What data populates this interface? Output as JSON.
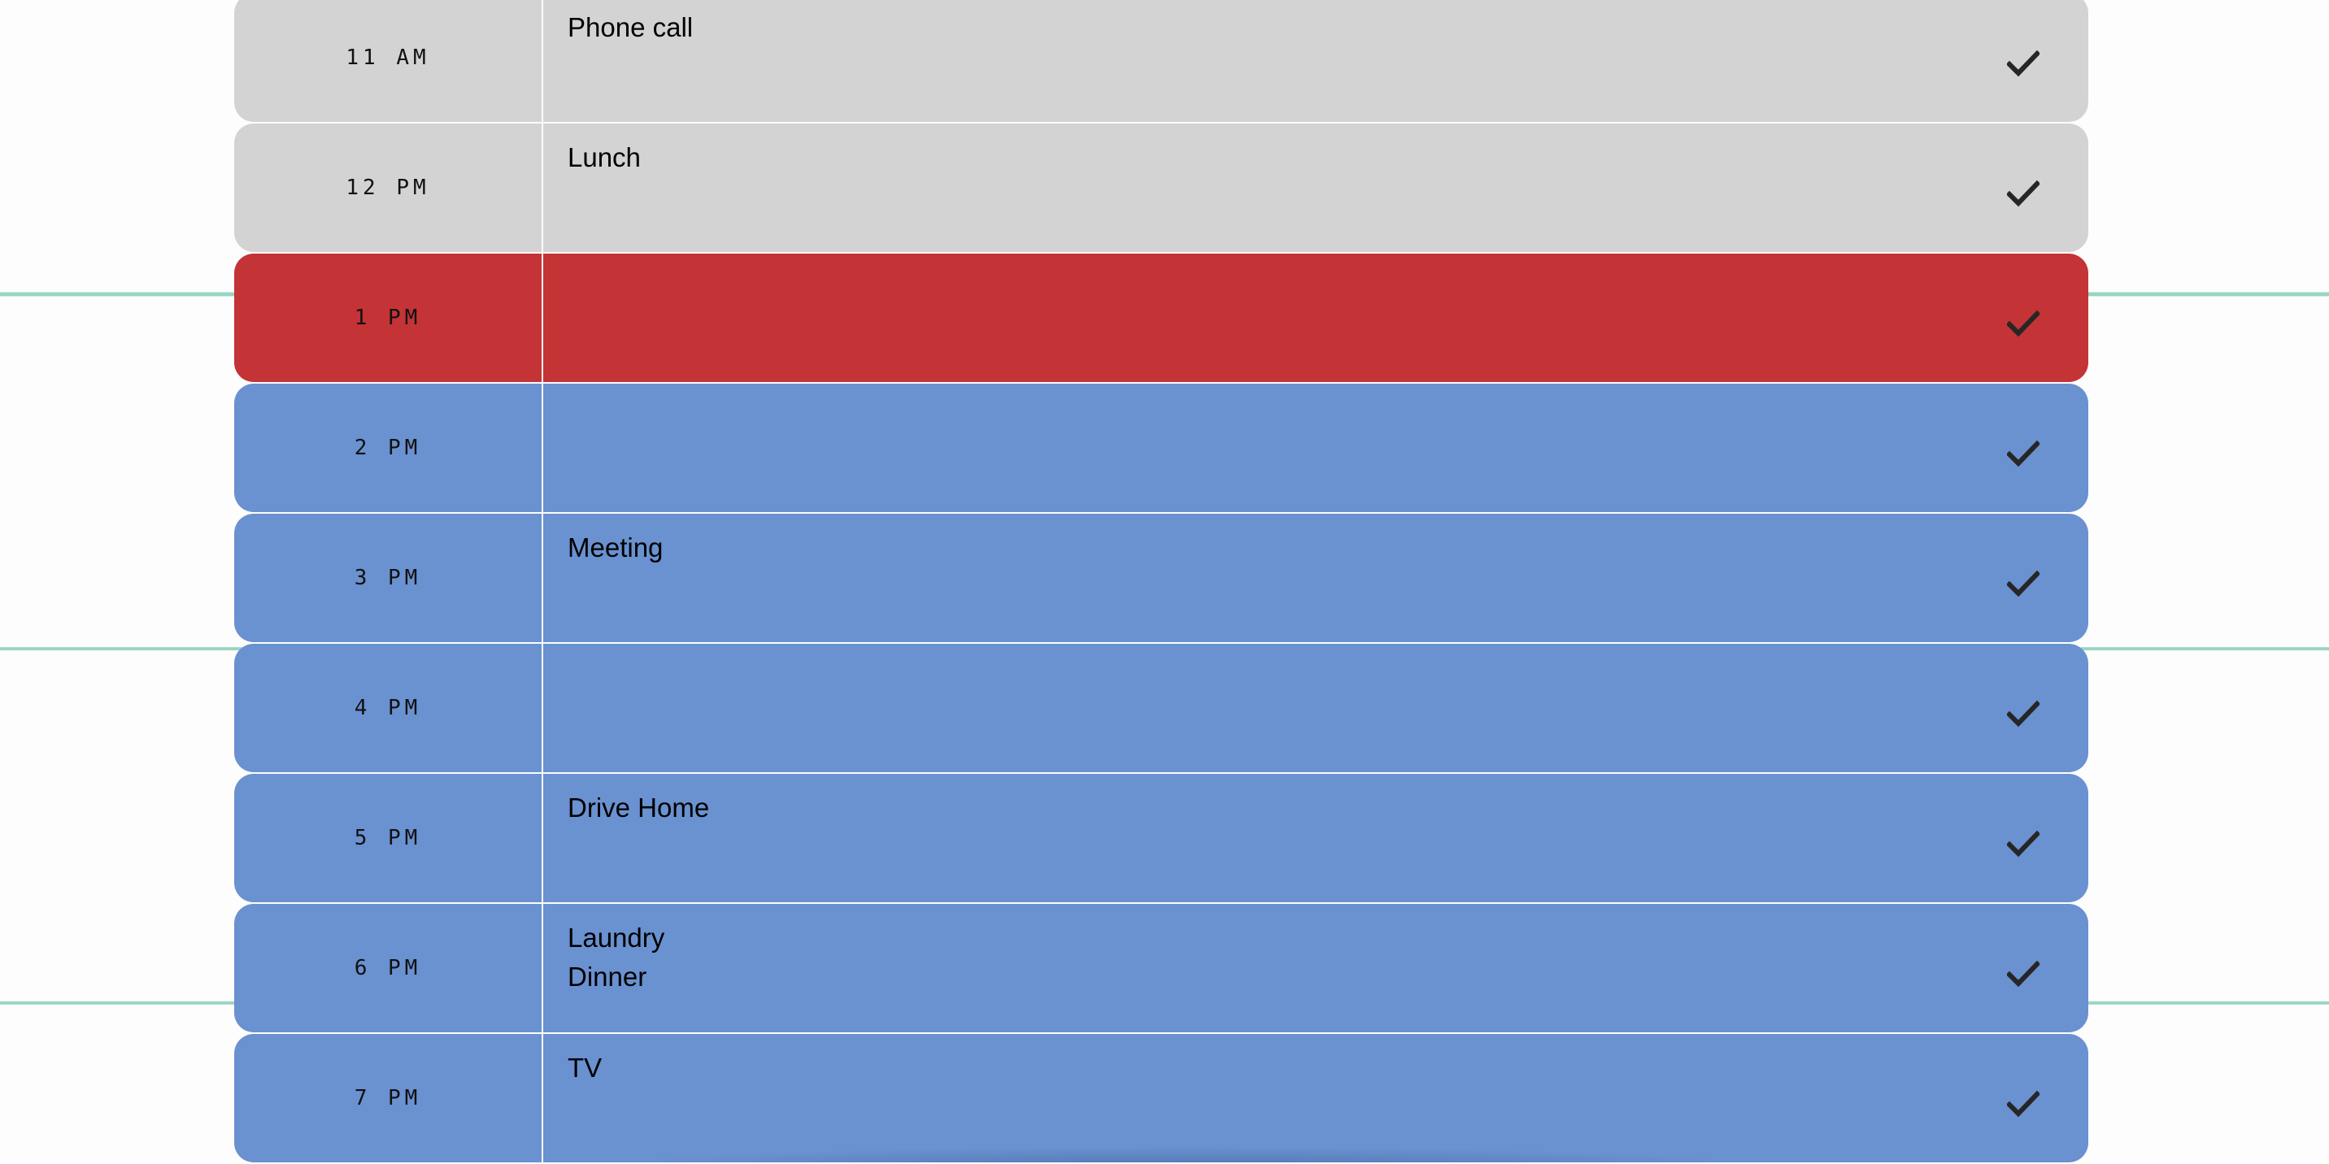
{
  "colors": {
    "past": "#d3d3d3",
    "present": "#c43335",
    "future": "#6a91d0",
    "rule_lines": "#97d5c1"
  },
  "save_icon": "check-icon",
  "rows": [
    {
      "hour": "11 AM",
      "text": "Phone call",
      "state": "past"
    },
    {
      "hour": "12 PM",
      "text": "Lunch",
      "state": "past"
    },
    {
      "hour": "1 PM",
      "text": "",
      "state": "present"
    },
    {
      "hour": "2 PM",
      "text": "",
      "state": "future"
    },
    {
      "hour": "3 PM",
      "text": "Meeting",
      "state": "future"
    },
    {
      "hour": "4 PM",
      "text": "",
      "state": "future"
    },
    {
      "hour": "5 PM",
      "text": "Drive Home",
      "state": "future"
    },
    {
      "hour": "6 PM",
      "text": "Laundry\nDinner",
      "state": "future"
    },
    {
      "hour": "7 PM",
      "text": "TV",
      "state": "future"
    }
  ]
}
